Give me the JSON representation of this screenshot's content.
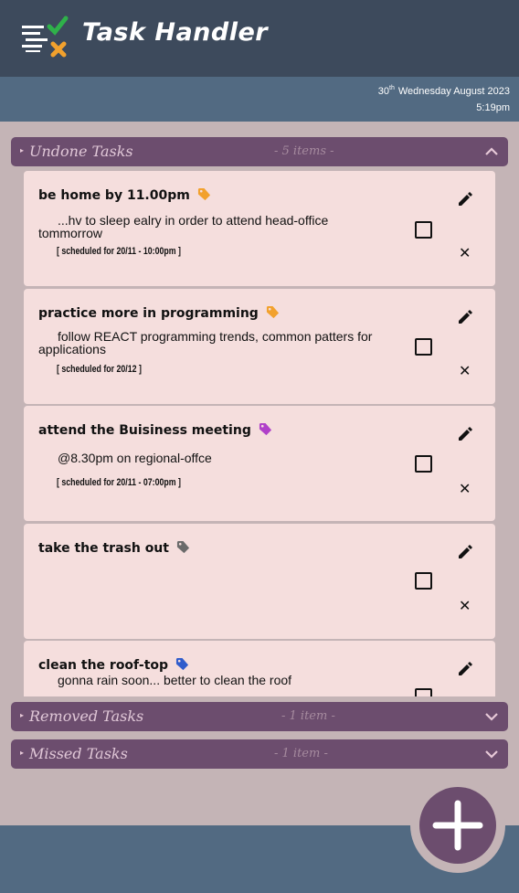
{
  "header": {
    "title": "Task Handler"
  },
  "datebar": {
    "day": "30",
    "day_suffix": "th",
    "date_rest": "Wednesday August 2023",
    "time": "5:19pm"
  },
  "sections": {
    "undone": {
      "title": "Undone Tasks",
      "count": "- 5 items -"
    },
    "removed": {
      "title": "Removed Tasks",
      "count": "- 1 item -"
    },
    "missed": {
      "title": "Missed Tasks",
      "count": "- 1 item -"
    }
  },
  "tasks": [
    {
      "title": "be home by 11.00pm",
      "tag_color": "#f2a12d",
      "description": "...hv to sleep ealry in order to attend head-office tommorrow",
      "schedule": "[ scheduled for 20/11 - 10:00pm ]"
    },
    {
      "title": "practice more in programming",
      "tag_color": "#f2a12d",
      "description": "follow REACT programming trends, common patters for applications",
      "schedule": "[ scheduled for 20/12 ]"
    },
    {
      "title": "attend the Buisiness meeting",
      "tag_color": "#b040c9",
      "description": "@8.30pm on regional-offce",
      "schedule": "[ scheduled for 20/11 - 07:00pm ]"
    },
    {
      "title": "take the trash out",
      "tag_color": "#6b6b6b",
      "description": "",
      "schedule": ""
    },
    {
      "title": "clean the roof-top",
      "tag_color": "#2f5ccc",
      "description": "gonna rain soon... better to clean the roof",
      "schedule": ""
    }
  ],
  "icons": {
    "logo": "checklist-logo-icon",
    "edit": "pencil-icon",
    "delete": "close-icon",
    "tag": "tag-icon",
    "add": "plus-icon",
    "expand": "chevron-icon"
  },
  "colors": {
    "header": "#3d4a5c",
    "datebar": "#526a82",
    "section": "#6c4d6e",
    "card": "#f5dedd",
    "background": "#c4b4b6"
  }
}
